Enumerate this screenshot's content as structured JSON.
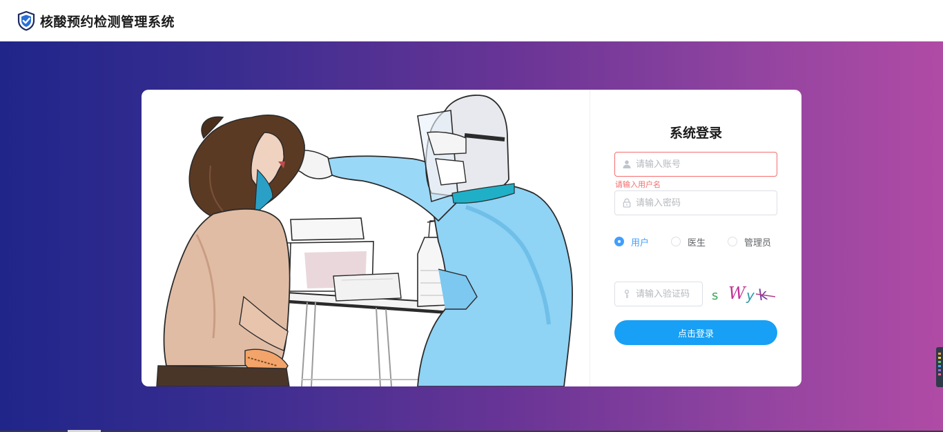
{
  "header": {
    "title": "核酸预约检测管理系统",
    "logo_icon": "shield-check-icon"
  },
  "login": {
    "title": "系统登录",
    "username": {
      "placeholder": "请输入账号",
      "value": "",
      "error": "请输入用户名",
      "icon": "user-icon"
    },
    "password": {
      "placeholder": "请输入密码",
      "value": "",
      "icon": "lock-icon"
    },
    "roles": [
      {
        "label": "用户",
        "checked": true
      },
      {
        "label": "医生",
        "checked": false
      },
      {
        "label": "管理员",
        "checked": false
      }
    ],
    "captcha": {
      "placeholder": "请输入验证码",
      "value": "",
      "icon": "key-icon",
      "code": "swyk"
    },
    "submit_label": "点击登录"
  },
  "colors": {
    "accent": "#17a0f5",
    "radio_active": "#409eff",
    "error": "#f56c6c",
    "gradient_start": "#20258a",
    "gradient_end": "#b04ba5"
  }
}
